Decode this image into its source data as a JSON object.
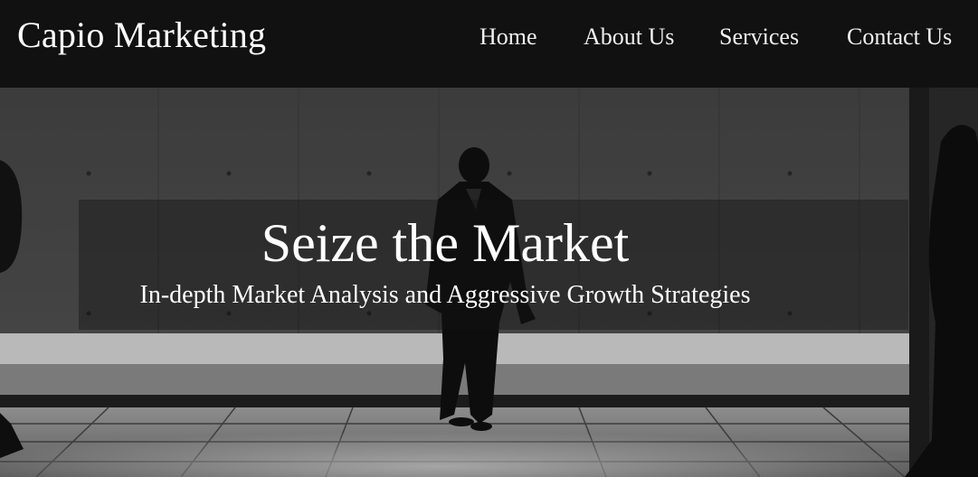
{
  "header": {
    "brand": "Capio Marketing",
    "nav": [
      {
        "label": "Home"
      },
      {
        "label": "About Us"
      },
      {
        "label": "Services"
      },
      {
        "label": "Contact Us"
      }
    ]
  },
  "hero": {
    "title": "Seize the Market",
    "subtitle": "In-depth Market Analysis and Aggressive Growth Strategies"
  },
  "colors": {
    "nav_background": "#111111",
    "text": "#ffffff"
  }
}
